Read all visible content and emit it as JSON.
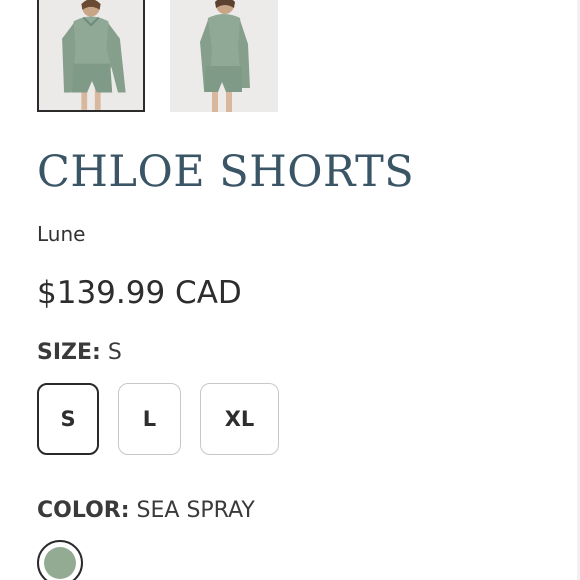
{
  "product": {
    "title": "CHLOE SHORTS",
    "vendor": "Lune",
    "price": "$139.99 CAD"
  },
  "gallery": {
    "thumbnails": [
      {
        "alt": "product-photo-front",
        "selected": true
      },
      {
        "alt": "product-photo-side",
        "selected": false
      }
    ]
  },
  "size_option": {
    "label": "SIZE:",
    "selected_value": "S",
    "values": [
      "S",
      "L",
      "XL"
    ]
  },
  "color_option": {
    "label": "COLOR:",
    "selected_value": "SEA SPRAY",
    "swatch_color": "#93ab93"
  },
  "colors": {
    "title": "#3a5565",
    "garment": "#8fa996",
    "garment_shadow": "#7a9582"
  }
}
